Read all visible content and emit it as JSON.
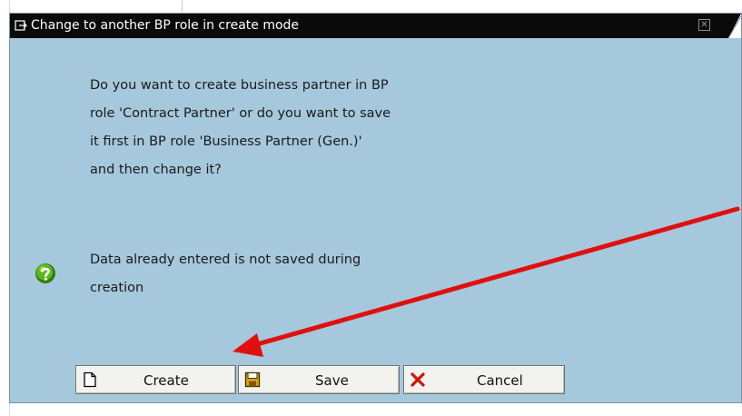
{
  "dialog": {
    "title": "Change to another BP role in create mode",
    "message_lines": [
      "Do you want to create business partner in BP",
      "role 'Contract Partner' or do you want to save",
      "it first in BP role 'Business Partner (Gen.)'",
      "and then change it?"
    ],
    "note_lines": [
      "Data already entered is not saved during",
      "creation"
    ],
    "icon": "question-icon"
  },
  "buttons": {
    "create_label": "Create",
    "save_label": "Save",
    "cancel_label": "Cancel"
  },
  "colors": {
    "dialog_bg": "#a6c8dc",
    "titlebar_bg": "#0a0a0a",
    "arrow": "#e01010",
    "question_icon": "#3a9a12"
  }
}
